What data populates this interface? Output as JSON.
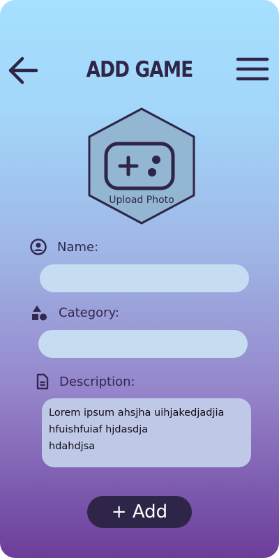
{
  "header": {
    "title": "ADD GAME",
    "back_icon": "arrow-left-icon",
    "menu_icon": "hamburger-menu-icon"
  },
  "upload": {
    "label": "Upload Photo",
    "icon": "gamepad-icon"
  },
  "form": {
    "name": {
      "label": "Name:",
      "icon": "user-circle-icon",
      "value": ""
    },
    "category": {
      "label": "Category:",
      "icon": "shapes-icon",
      "value": ""
    },
    "description": {
      "label": "Description:",
      "icon": "document-icon",
      "value": "Lorem ipsum ahsjha uihjakedjadjia hfuishfuiaf hjdasdja\nhdahdjsa"
    }
  },
  "actions": {
    "add_label": "+ Add"
  },
  "colors": {
    "primary": "#2f2548",
    "gradient_top": "#a6e0fe",
    "gradient_bottom": "#6c3d9a",
    "input_bg": "#c6dcf0"
  }
}
